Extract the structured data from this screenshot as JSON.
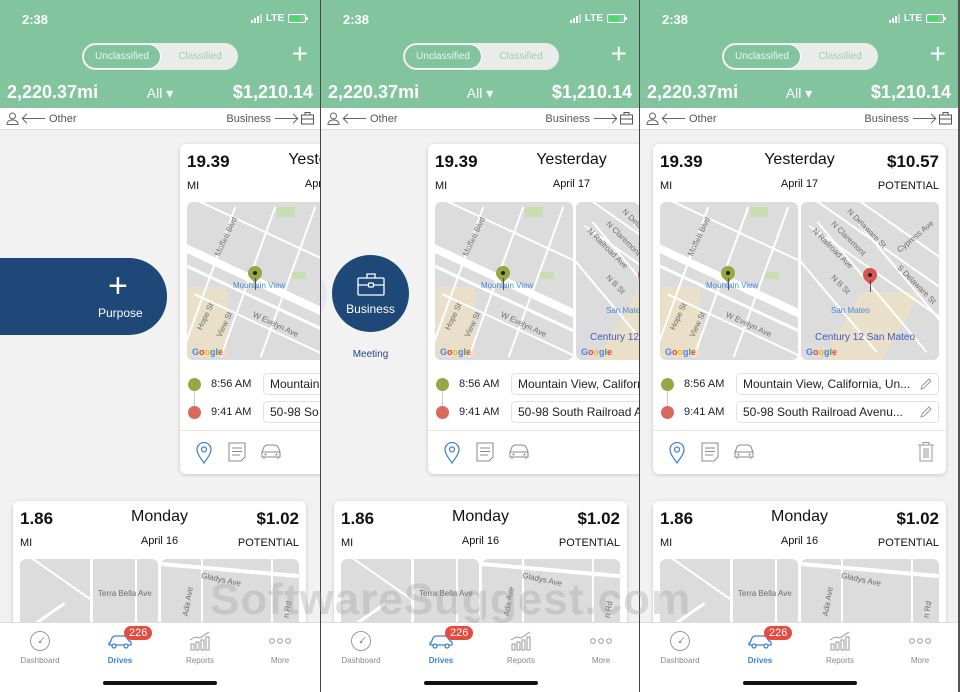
{
  "status_bar": {
    "time": "2:38",
    "network": "LTE"
  },
  "header": {
    "segments": [
      "Unclassified",
      "Classified"
    ],
    "active_segment": "Unclassified",
    "add_label": "+",
    "total_miles": "2,220.37mi",
    "filter": "All ▾",
    "total_value": "$1,210.14"
  },
  "swipe_hint": {
    "left_label": "Other",
    "right_label": "Business"
  },
  "swipe_actions": {
    "purpose_label": "Purpose",
    "purpose_icon": "+",
    "business_label": "Business",
    "meeting_label": "Meeting"
  },
  "drives": [
    {
      "miles": "19.39",
      "unit": "MI",
      "day": "Yesterday",
      "date": "April 17",
      "value": "$10.57",
      "value_label": "POTENTIAL",
      "start_map": {
        "streets": [
          "Moffett Blvd",
          "Hope St",
          "View St",
          "W Evelyn Ave"
        ],
        "poi": "Mountain View"
      },
      "end_map": {
        "streets": [
          "N Delaware St",
          "N Claremont",
          "N Railroad Ave",
          "N B St",
          "Cypress Ave",
          "S Delaware St"
        ],
        "poi": "San Mateo",
        "poi_large": "Century 12 San Mateo"
      },
      "stops": [
        {
          "time": "8:56 AM",
          "address": "Mountain View, California, Un...",
          "color": "#95a845"
        },
        {
          "time": "9:41 AM",
          "address": "50-98 South Railroad Avenu...",
          "color": "#d9685e"
        }
      ],
      "crop_addresses": [
        "Mountain View, Califorr",
        "50-98 South Railroad A"
      ],
      "crop_addresses_narrow": [
        "Mountain",
        "50-98 So"
      ]
    },
    {
      "miles": "1.86",
      "unit": "MI",
      "day": "Monday",
      "date": "April 16",
      "value": "$1.02",
      "value_label": "POTENTIAL",
      "start_map": {
        "streets": [
          "Terra Bella Ave"
        ]
      },
      "end_map": {
        "streets": [
          "Gladys Ave",
          "Ada Ave",
          "n Rd"
        ]
      }
    }
  ],
  "map_attribution": "Google",
  "tabbar": {
    "tabs": [
      {
        "label": "Dashboard",
        "icon": "speedometer-icon"
      },
      {
        "label": "Drives",
        "icon": "car-icon",
        "badge": "226"
      },
      {
        "label": "Reports",
        "icon": "bar-chart-icon"
      },
      {
        "label": "More",
        "icon": "more-dots-icon"
      }
    ],
    "active": "Drives"
  },
  "watermark": "SoftwareSuggest.com",
  "colors": {
    "header_green": "#82c49d",
    "navy": "#1d4877",
    "start_dot": "#95a845",
    "end_dot": "#d9685e",
    "active_tab": "#3d80d8",
    "badge": "#e74a3f"
  }
}
